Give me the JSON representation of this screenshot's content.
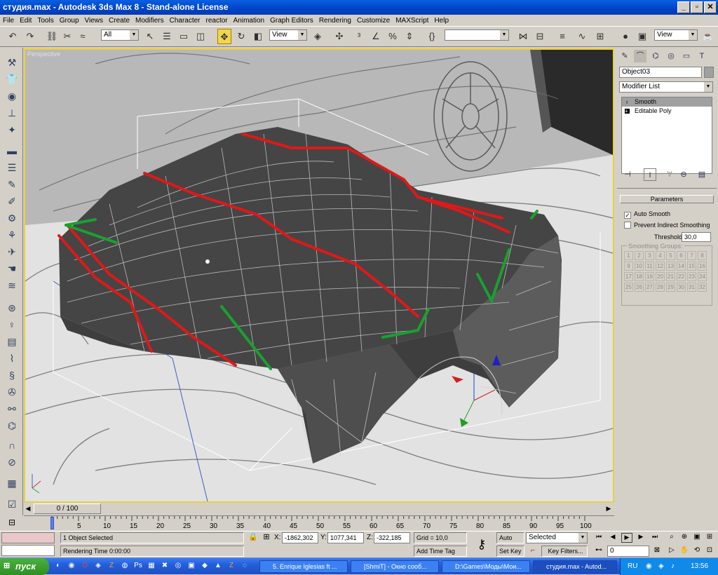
{
  "window": {
    "title": "студия.max - Autodesk 3ds Max 8  - Stand-alone License",
    "minimize": "_",
    "maximize": "▫",
    "close": "✕"
  },
  "menu": [
    "File",
    "Edit",
    "Tools",
    "Group",
    "Views",
    "Create",
    "Modifiers",
    "Character",
    "reactor",
    "Animation",
    "Graph Editors",
    "Rendering",
    "Customize",
    "MAXScript",
    "Help"
  ],
  "toolbar": {
    "selection_filter": "All",
    "reference_coord": "View",
    "named_selection": "",
    "render_view": "View"
  },
  "viewport": {
    "label": "Perspective"
  },
  "command_panel": {
    "object_name": "Object03",
    "modifier_list": "Modifier List",
    "modifier_stack": [
      {
        "label": "Smooth",
        "selected": true,
        "icon": "bulb-icon"
      },
      {
        "label": "Editable Poly",
        "selected": false,
        "icon": "plus-icon"
      }
    ],
    "rollout_title": "Parameters",
    "auto_smooth_label": "Auto Smooth",
    "auto_smooth_checked": true,
    "prevent_indirect_label": "Prevent Indirect Smoothing",
    "prevent_indirect_checked": false,
    "threshold_label": "Threshold:",
    "threshold_value": "30,0",
    "smoothing_groups_label": "Smoothing Groups:",
    "smoothing_groups": [
      "1",
      "2",
      "3",
      "4",
      "5",
      "6",
      "7",
      "8",
      "9",
      "10",
      "11",
      "12",
      "13",
      "14",
      "15",
      "16",
      "17",
      "18",
      "19",
      "20",
      "21",
      "22",
      "23",
      "24",
      "25",
      "26",
      "27",
      "28",
      "29",
      "30",
      "31",
      "32"
    ]
  },
  "timeline": {
    "frame_display": "0 / 100",
    "ruler_labels": [
      "0",
      "5",
      "10",
      "15",
      "20",
      "25",
      "30",
      "35",
      "40",
      "45",
      "50",
      "55",
      "60",
      "65",
      "70",
      "75",
      "80",
      "85",
      "90",
      "95",
      "100"
    ]
  },
  "status": {
    "selection": "1 Object Selected",
    "prompt": "Rendering Time  0:00:00",
    "x_label": "X:",
    "x_value": "-1862,302",
    "y_label": "Y:",
    "y_value": "1077,341",
    "z_label": "Z:",
    "z_value": "-322,185",
    "grid": "Grid = 10,0",
    "add_time_tag": "Add Time Tag",
    "auto_key": "Auto Key",
    "set_key": "Set Key",
    "key_mode": "Selected",
    "key_filters": "Key Filters...",
    "current_frame": "0"
  },
  "taskbar": {
    "start_label": "пуск",
    "tasks": [
      {
        "label": "5. Enrique Iglesias ft ...",
        "active": false
      },
      {
        "label": "[ShmiT] - Окно сооб...",
        "active": false
      },
      {
        "label": "D:\\Games\\Моды\\Мои...",
        "active": false
      },
      {
        "label": "студия.max - Autod...",
        "active": true
      }
    ],
    "language": "RU",
    "clock": "13:56"
  },
  "colors": {
    "accent_active": "#f2d64b",
    "edge_red": "#e01818",
    "edge_green": "#1aa030",
    "titlebar": "#0a5fe0"
  }
}
